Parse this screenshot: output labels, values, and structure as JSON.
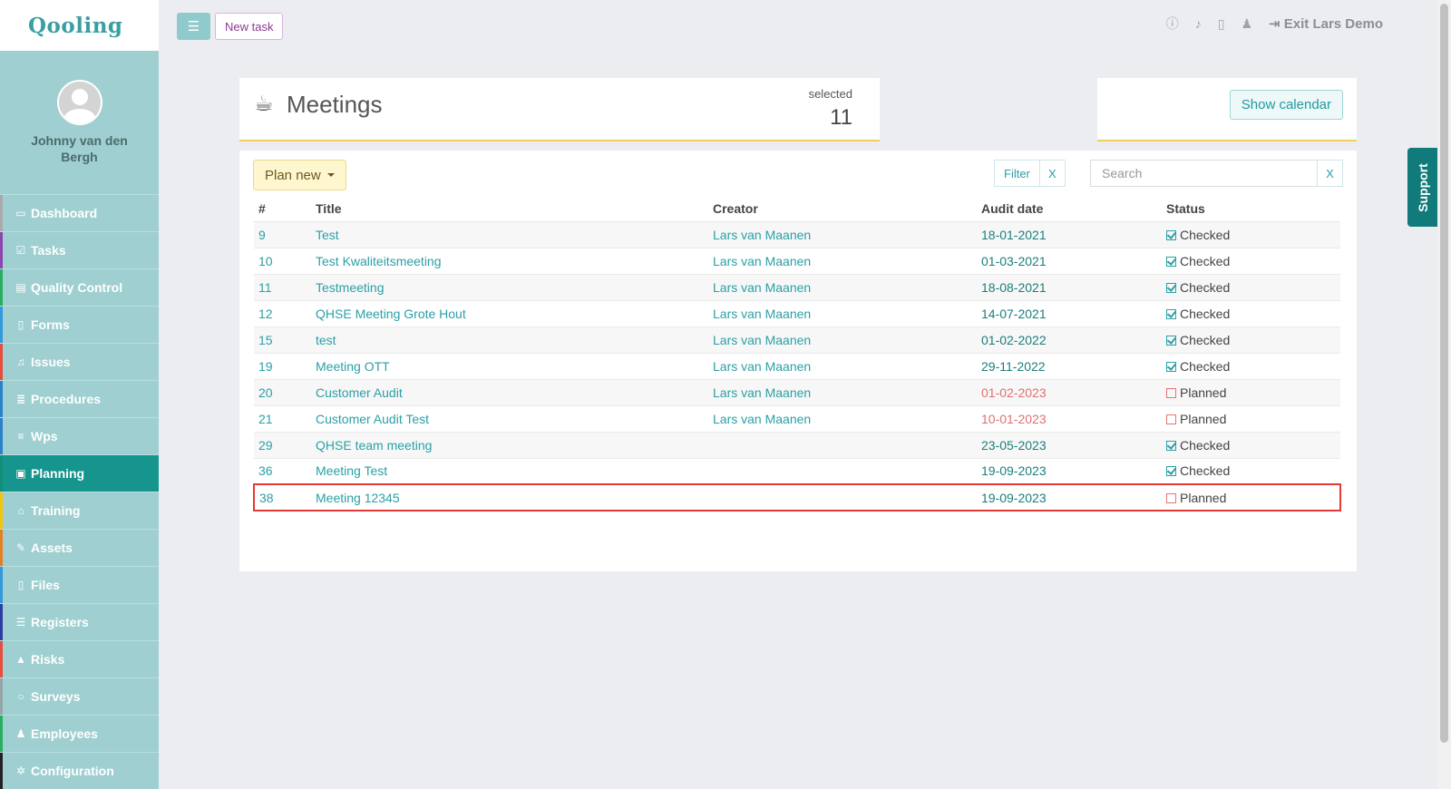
{
  "app": {
    "logo": "Qooling"
  },
  "profile": {
    "name": "Johnny van den Bergh"
  },
  "sidebar": {
    "items": [
      {
        "label": "Dashboard",
        "icon": "monitor-icon",
        "glyph": "▭",
        "accent": "#a9a9a9",
        "active": false
      },
      {
        "label": "Tasks",
        "icon": "check-square-icon",
        "glyph": "☑",
        "accent": "#8e44ad",
        "active": false
      },
      {
        "label": "Quality Control",
        "icon": "book-icon",
        "glyph": "▤",
        "accent": "#27ae60",
        "active": false
      },
      {
        "label": "Forms",
        "icon": "file-icon",
        "glyph": "▯",
        "accent": "#3498db",
        "active": false
      },
      {
        "label": "Issues",
        "icon": "bell-icon",
        "glyph": "♫",
        "accent": "#e74c3c",
        "active": false
      },
      {
        "label": "Procedures",
        "icon": "list-icon",
        "glyph": "≣",
        "accent": "#2c82c9",
        "active": false
      },
      {
        "label": "Wps",
        "icon": "list-alt-icon",
        "glyph": "≡",
        "accent": "#2c82c9",
        "active": false
      },
      {
        "label": "Planning",
        "icon": "calendar-check-icon",
        "glyph": "▣",
        "accent": "#138d75",
        "active": true
      },
      {
        "label": "Training",
        "icon": "graduation-cap-icon",
        "glyph": "⌂",
        "accent": "#f1c40f",
        "active": false
      },
      {
        "label": "Assets",
        "icon": "wrench-icon",
        "glyph": "✎",
        "accent": "#e67e22",
        "active": false
      },
      {
        "label": "Files",
        "icon": "file-pdf-icon",
        "glyph": "▯",
        "accent": "#3498db",
        "active": false
      },
      {
        "label": "Registers",
        "icon": "bars-icon",
        "glyph": "☰",
        "accent": "#2c3e9f",
        "active": false
      },
      {
        "label": "Risks",
        "icon": "warning-icon",
        "glyph": "▲",
        "accent": "#e74c3c",
        "active": false
      },
      {
        "label": "Surveys",
        "icon": "comment-icon",
        "glyph": "○",
        "accent": "#95a5a6",
        "active": false
      },
      {
        "label": "Employees",
        "icon": "users-icon",
        "glyph": "♟",
        "accent": "#27ae60",
        "active": false
      },
      {
        "label": "Configuration",
        "icon": "gear-icon",
        "glyph": "✲",
        "accent": "#222222",
        "active": false
      }
    ]
  },
  "topbar": {
    "new_task_label": "New task",
    "exit_label": "Exit Lars Demo"
  },
  "page": {
    "title": "Meetings",
    "selected_label": "selected",
    "selected_count": "11",
    "show_calendar_label": "Show calendar",
    "plan_new_label": "Plan new",
    "filter_label": "Filter",
    "filter_clear_label": "X",
    "search_placeholder": "Search",
    "search_clear_label": "X"
  },
  "table": {
    "columns": [
      "#",
      "Title",
      "Creator",
      "Audit date",
      "Status"
    ],
    "rows": [
      {
        "id": "9",
        "title": "Test",
        "creator": "Lars van Maanen",
        "date": "18-01-2021",
        "status": "Checked",
        "overdue": false,
        "highlight": false
      },
      {
        "id": "10",
        "title": "Test Kwaliteitsmeeting",
        "creator": "Lars van Maanen",
        "date": "01-03-2021",
        "status": "Checked",
        "overdue": false,
        "highlight": false
      },
      {
        "id": "11",
        "title": "Testmeeting",
        "creator": "Lars van Maanen",
        "date": "18-08-2021",
        "status": "Checked",
        "overdue": false,
        "highlight": false
      },
      {
        "id": "12",
        "title": "QHSE Meeting Grote Hout",
        "creator": "Lars van Maanen",
        "date": "14-07-2021",
        "status": "Checked",
        "overdue": false,
        "highlight": false
      },
      {
        "id": "15",
        "title": "test",
        "creator": "Lars van Maanen",
        "date": "01-02-2022",
        "status": "Checked",
        "overdue": false,
        "highlight": false
      },
      {
        "id": "19",
        "title": "Meeting OTT",
        "creator": "Lars van Maanen",
        "date": "29-11-2022",
        "status": "Checked",
        "overdue": false,
        "highlight": false
      },
      {
        "id": "20",
        "title": "Customer Audit",
        "creator": "Lars van Maanen",
        "date": "01-02-2023",
        "status": "Planned",
        "overdue": true,
        "highlight": false
      },
      {
        "id": "21",
        "title": "Customer Audit Test",
        "creator": "Lars van Maanen",
        "date": "10-01-2023",
        "status": "Planned",
        "overdue": true,
        "highlight": false
      },
      {
        "id": "29",
        "title": "QHSE team meeting",
        "creator": "",
        "date": "23-05-2023",
        "status": "Checked",
        "overdue": false,
        "highlight": false
      },
      {
        "id": "36",
        "title": "Meeting Test",
        "creator": "",
        "date": "19-09-2023",
        "status": "Checked",
        "overdue": false,
        "highlight": false
      },
      {
        "id": "38",
        "title": "Meeting 12345",
        "creator": "",
        "date": "19-09-2023",
        "status": "Planned",
        "overdue": false,
        "highlight": true
      }
    ]
  },
  "support": {
    "label": "Support"
  }
}
